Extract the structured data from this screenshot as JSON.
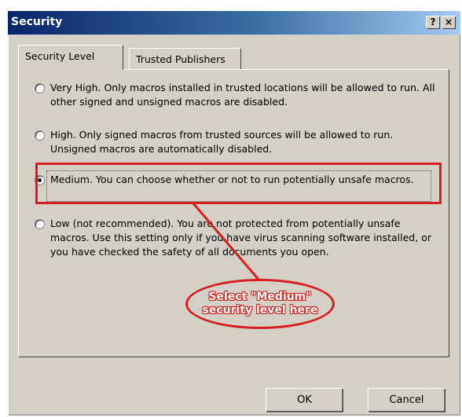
{
  "dialog": {
    "title": "Security",
    "help_glyph": "?",
    "close_glyph": "×"
  },
  "tabs": [
    {
      "label": "Security Level",
      "active": true
    },
    {
      "label": "Trusted Publishers",
      "active": false
    }
  ],
  "options": [
    {
      "label": "Very High. Only macros installed in trusted locations will be allowed to run. All other signed and unsigned macros are disabled.",
      "checked": false
    },
    {
      "label": "High. Only signed macros from trusted sources will be allowed to run. Unsigned macros are automatically disabled.",
      "checked": false
    },
    {
      "label": "Medium. You can choose whether or not to run potentially unsafe macros.",
      "checked": true
    },
    {
      "label": "Low (not recommended). You are not protected from potentially unsafe macros. Use this setting only if you have virus scanning software installed, or you have checked the safety of all documents you open.",
      "checked": false
    }
  ],
  "annotation": {
    "line1": "Select \"Medium\"",
    "line2": "security level here",
    "color": "#d42020"
  },
  "buttons": {
    "ok_label": "OK",
    "cancel_label": "Cancel"
  }
}
